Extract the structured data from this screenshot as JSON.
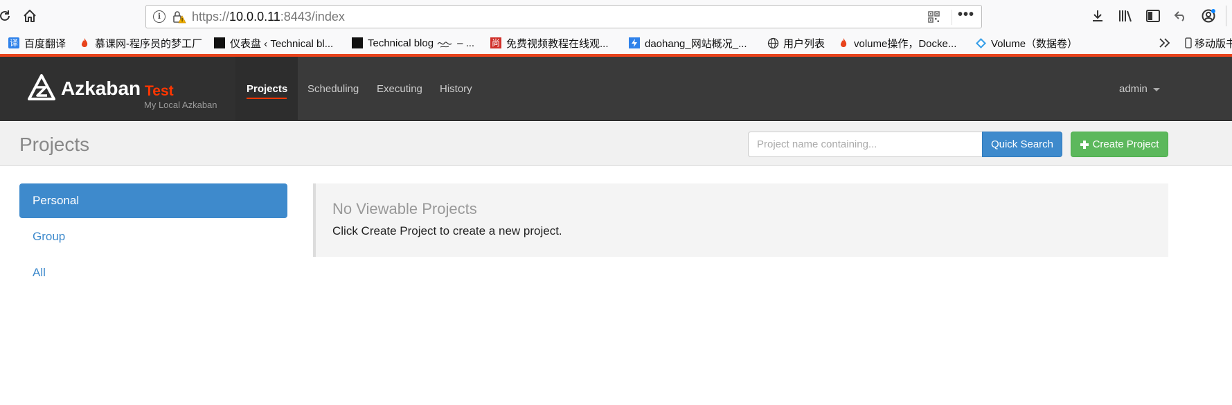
{
  "browser": {
    "url_prefix": "https://",
    "url_host": "10.0.0.11",
    "url_rest": ":8443/index",
    "bookmarks": [
      {
        "label": "百度翻译",
        "icon": "translate-icon",
        "color": "#2f82ea"
      },
      {
        "label": "慕课网-程序员的梦工厂",
        "icon": "flame-icon",
        "color": "#e8431c"
      },
      {
        "label": "仪表盘 ‹ Technical bl...",
        "icon": "site-icon",
        "color": "#111111"
      },
      {
        "label": "Technical blog",
        "icon": "site-icon",
        "color": "#111111"
      },
      {
        "label": "– ...",
        "icon": "",
        "color": ""
      },
      {
        "label": "免费视频教程在线观...",
        "icon": "shang-icon",
        "color": "#d0302a"
      },
      {
        "label": "daohang_网站概况_...",
        "icon": "bolt-icon",
        "color": "#2f82ea"
      },
      {
        "label": "用户列表",
        "icon": "globe-icon",
        "color": "#333333"
      },
      {
        "label": "volume操作，Docke...",
        "icon": "flame-icon",
        "color": "#e8431c"
      },
      {
        "label": "Volume（数据卷）",
        "icon": "diamond-icon",
        "color": "#3aa0e8"
      },
      {
        "label": "移动版书签",
        "icon": "mobile-icon",
        "color": "#333333"
      }
    ],
    "bookmark_glyphs": {
      "translate": "译",
      "shang": "尚"
    }
  },
  "navbar": {
    "brand_name": "Azkaban",
    "brand_env": "Test",
    "brand_subtitle": "My Local Azkaban",
    "items": [
      {
        "label": "Projects",
        "active": true
      },
      {
        "label": "Scheduling",
        "active": false
      },
      {
        "label": "Executing",
        "active": false
      },
      {
        "label": "History",
        "active": false
      }
    ],
    "user": "admin"
  },
  "header": {
    "title": "Projects",
    "search_placeholder": "Project name containing...",
    "quick_search_label": "Quick Search",
    "create_project_label": "Create Project"
  },
  "sidebar": {
    "items": [
      {
        "label": "Personal",
        "active": true
      },
      {
        "label": "Group",
        "active": false
      },
      {
        "label": "All",
        "active": false
      }
    ]
  },
  "main": {
    "empty_title": "No Viewable Projects",
    "empty_text": "Click Create Project to create a new project."
  },
  "colors": {
    "accent": "#ff3601",
    "primary": "#3e8acc",
    "success": "#5cb85c",
    "navbar": "#3a3a3a"
  }
}
